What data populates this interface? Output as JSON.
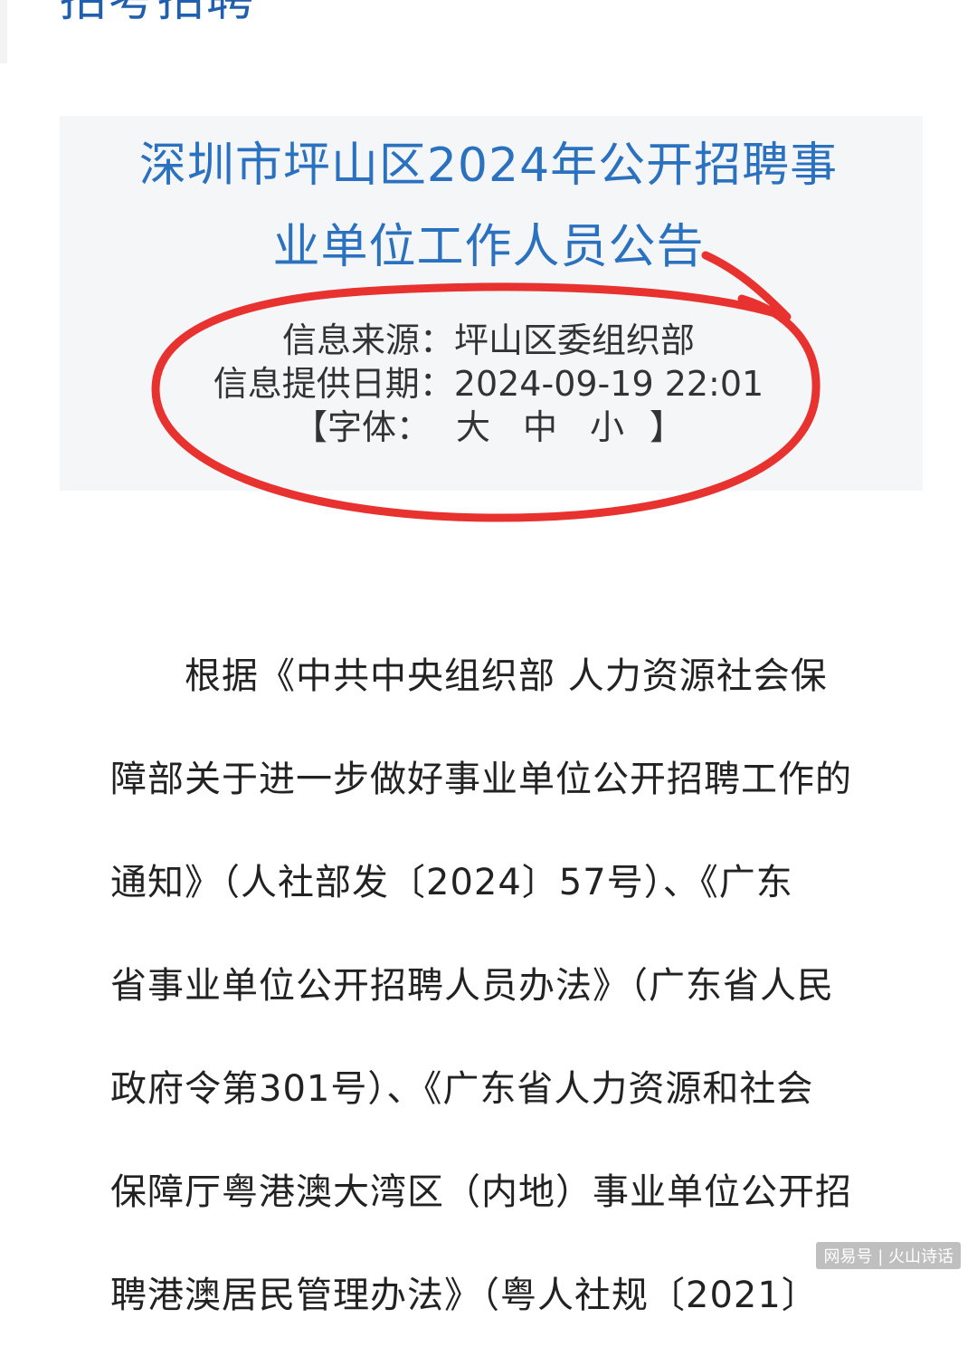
{
  "top_heading": "招考招聘",
  "announcement": {
    "title_line1": "深圳市坪山区2024年公开招聘事",
    "title_line2": "业单位工作人员公告",
    "source": "信息来源：坪山区委组织部",
    "date": "信息提供日期：2024-09-19 22:01",
    "font_size": {
      "prefix": "【字体：",
      "large": "大",
      "medium": "中",
      "small": "小",
      "suffix": "】"
    }
  },
  "body_lines": [
    "根据《中共中央组织部 人力资源社会保",
    "障部关于进一步做好事业单位公开招聘工作的",
    "通知》（人社部发〔2024〕57号）、《广东",
    "省事业单位公开招聘人员办法》（广东省人民",
    "政府令第301号）、《广东省人力资源和社会",
    "保障厅粤港澳大湾区（内地）事业单位公开招",
    "聘港澳居民管理办法》（粤人社规〔2021〕"
  ],
  "watermark": "网易号 | 火山诗话",
  "colors": {
    "title_blue": "#2a71c0",
    "annotation_red": "#e8322f"
  }
}
